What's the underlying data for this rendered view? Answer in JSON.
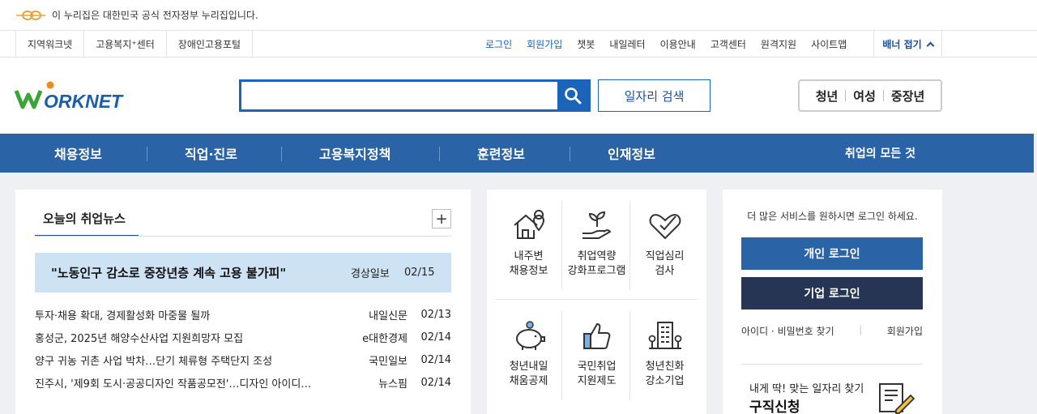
{
  "gov_banner": {
    "text": "이 누리집은 대한민국 공식 전자정부 누리집입니다."
  },
  "util_left": [
    "지역워크넷",
    "고용복지⁺센터",
    "장애인고용포털"
  ],
  "util_right": [
    {
      "label": "로그인",
      "accent": true
    },
    {
      "label": "회원가입",
      "accent": true
    },
    {
      "label": "챗봇",
      "accent": false
    },
    {
      "label": "내일레터",
      "accent": false
    },
    {
      "label": "이용안내",
      "accent": false
    },
    {
      "label": "고객센터",
      "accent": false
    },
    {
      "label": "원격지원",
      "accent": false
    },
    {
      "label": "사이트맵",
      "accent": false
    }
  ],
  "banner_toggle": "배너 접기",
  "search": {
    "value": "",
    "button_label": "일자리 검색"
  },
  "age_tabs": [
    "청년",
    "여성",
    "중장년"
  ],
  "gnb": [
    "채용정보",
    "직업·진로",
    "고용복지정책",
    "훈련정보",
    "인재정보"
  ],
  "gnb_all": "취업의 모든 것",
  "news": {
    "tab_label": "오늘의 취업뉴스",
    "more": "+",
    "highlight": {
      "title": "\"노동인구 감소로 중장년층 계속 고용 불가피\"",
      "source": "경상일보",
      "date": "02/15"
    },
    "items": [
      {
        "title": "투자·채용 확대, 경제활성화 마중물 될까",
        "source": "내일신문",
        "date": "02/13"
      },
      {
        "title": "홍성군, 2025년 해양수산사업 지원희망자 모집",
        "source": "e대한경제",
        "date": "02/14"
      },
      {
        "title": "양구 귀농 귀촌 사업 박차…단기 체류형 주택단지 조성",
        "source": "국민일보",
        "date": "02/14"
      },
      {
        "title": "진주시, '제9회 도시·공공디자인 작품공모전'…디자인 아이디…",
        "source": "뉴스핌",
        "date": "02/14"
      }
    ]
  },
  "services": [
    {
      "line1": "내주변",
      "line2": "채용정보",
      "icon": "house-pin-icon"
    },
    {
      "line1": "취업역량",
      "line2": "강화프로그램",
      "icon": "sprout-hand-icon"
    },
    {
      "line1": "직업심리",
      "line2": "검사",
      "icon": "heart-check-icon"
    },
    {
      "line1": "청년내일",
      "line2": "채움공제",
      "icon": "piggy-bank-icon"
    },
    {
      "line1": "국민취업",
      "line2": "지원제도",
      "icon": "thumbs-up-icon"
    },
    {
      "line1": "청년친화",
      "line2": "강소기업",
      "icon": "building-icon"
    }
  ],
  "login": {
    "message": "더 많은 서비스를 원하시면 로그인 하세요.",
    "personal": "개인 로그인",
    "company": "기업 로그인",
    "find": "아이디 · 비밀번호 찾기",
    "join": "회원가입"
  },
  "apply": {
    "sub": "내게 딱! 맞는 일자리 찾기",
    "title": "구직신청"
  },
  "colors": {
    "brand_blue": "#2a63a6",
    "accent_blue": "#1b64b8",
    "dark_navy": "#273555",
    "highlight_bg": "#cde2f2"
  }
}
